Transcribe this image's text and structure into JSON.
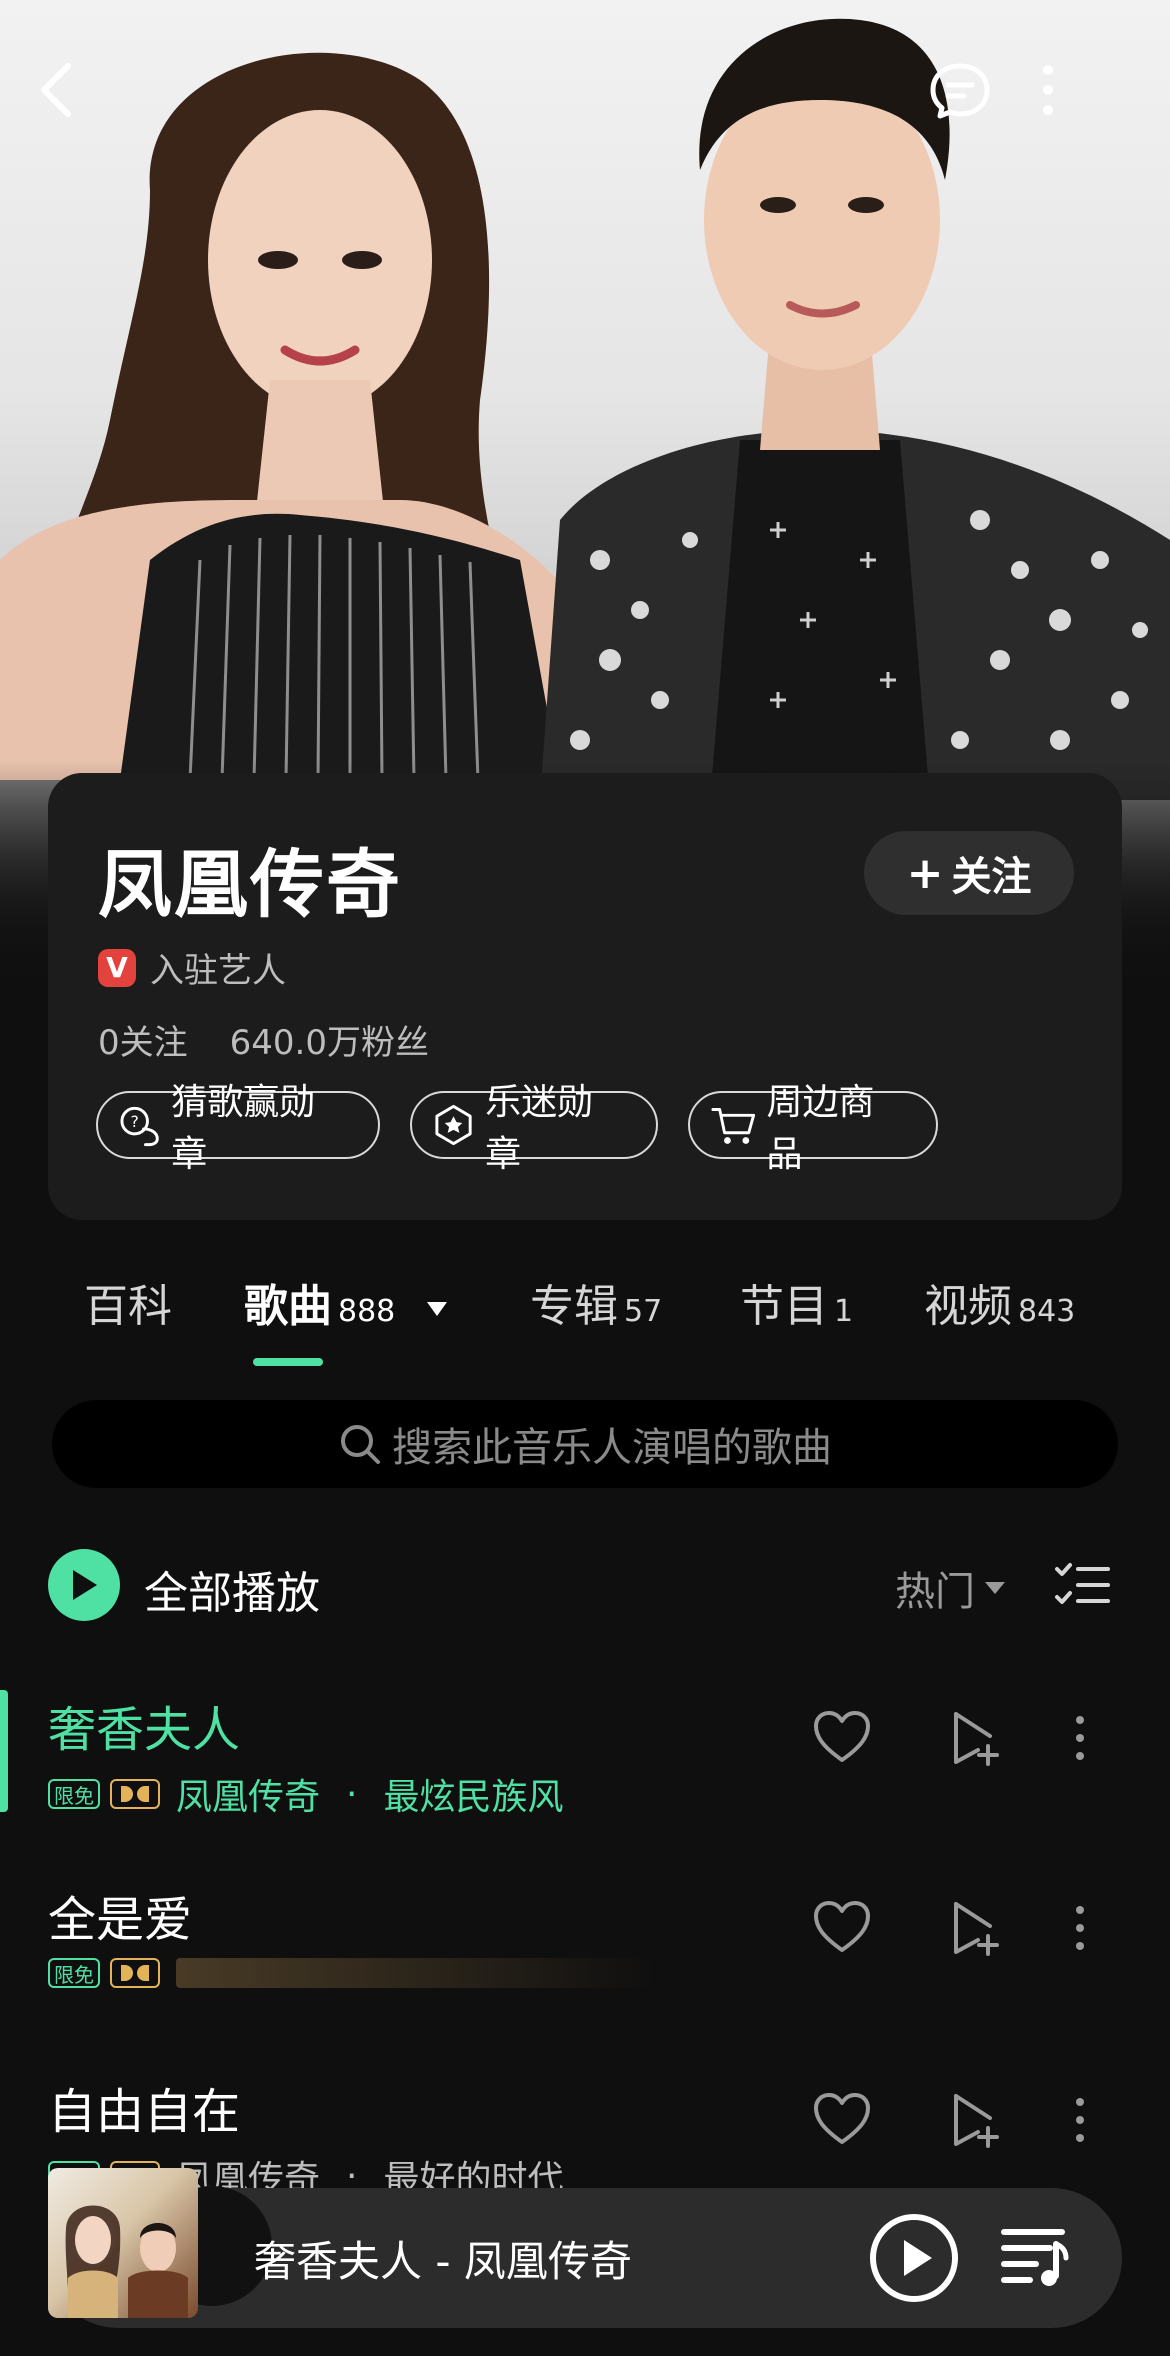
{
  "header": {
    "back_icon": "chevron-left-icon",
    "message_icon": "message-icon",
    "more_icon": "more-vertical-icon"
  },
  "artist": {
    "name": "凤凰传奇",
    "follow_label": "关注",
    "verified_label": "入驻艺人",
    "verified_badge": "V",
    "following": "0关注",
    "fans": "640.0万粉丝",
    "badges": [
      {
        "label": "猜歌赢勋章",
        "icon": "guess-song-icon"
      },
      {
        "label": "乐迷勋章",
        "icon": "fan-badge-icon"
      },
      {
        "label": "周边商品",
        "icon": "cart-icon"
      }
    ]
  },
  "tabs": [
    {
      "label": "百科",
      "count": ""
    },
    {
      "label": "歌曲",
      "count": "888"
    },
    {
      "label": "专辑",
      "count": "57"
    },
    {
      "label": "节目",
      "count": "1"
    },
    {
      "label": "视频",
      "count": "843"
    }
  ],
  "search": {
    "placeholder": "搜索此音乐人演唱的歌曲"
  },
  "list_header": {
    "play_all_label": "全部播放",
    "sort_label": "热门"
  },
  "songs": [
    {
      "title": "奢香夫人",
      "free_tag": "限免",
      "artist": "凤凰传奇",
      "album": "最炫民族风",
      "active": true
    },
    {
      "title": "全是爱",
      "free_tag": "限免",
      "artist": "",
      "album": "",
      "active": false
    },
    {
      "title": "自由自在",
      "free_tag": "限免",
      "artist": "凤凰传奇",
      "album": "最好的时代",
      "active": false
    }
  ],
  "player": {
    "now_playing": "奢香夫人 - 凤凰传奇"
  },
  "colors": {
    "accent": "#4fe0a3",
    "background": "#0f0f0f",
    "card": "#1c1c1c",
    "verified": "#e2433c",
    "dolby": "#e3b35a"
  }
}
